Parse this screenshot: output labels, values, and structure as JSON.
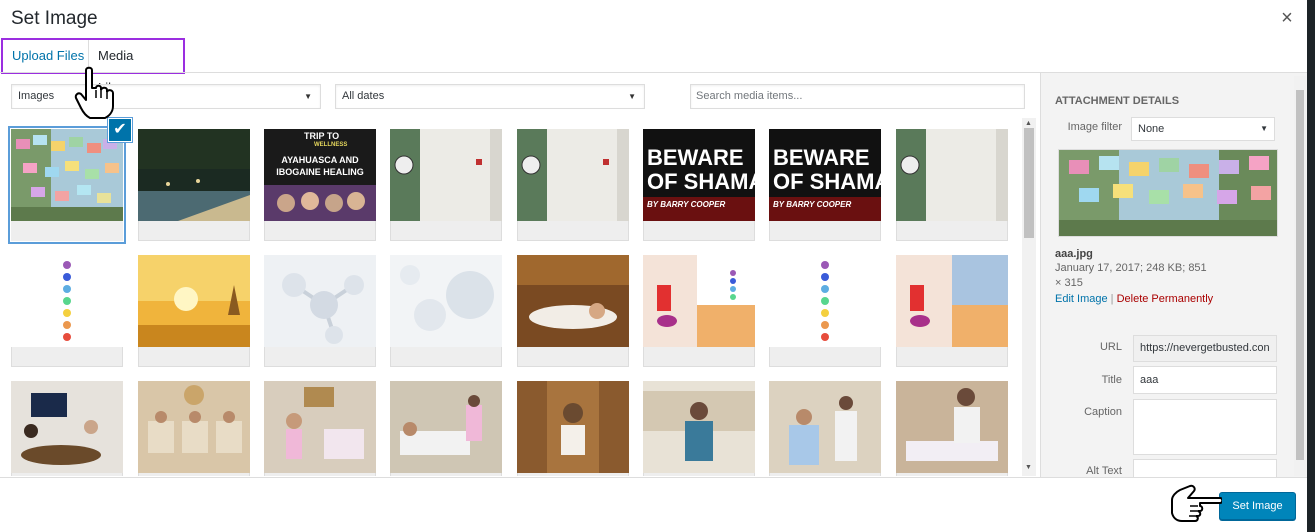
{
  "modal": {
    "title": "Set Image",
    "close_label": "×"
  },
  "tabs": [
    {
      "label": "Upload Files"
    },
    {
      "label": "Media Library"
    }
  ],
  "filters": {
    "type_select": "Images",
    "date_select": "All dates",
    "search_placeholder": "Search media items..."
  },
  "thumbnails": [
    {
      "text": ""
    },
    {
      "text": ""
    },
    {
      "text": "TRIP TO WELLNESS AYAHUASCA AND IBOGAINE HEALING"
    },
    {
      "text": ""
    },
    {
      "text": ""
    },
    {
      "text": "BEWARE OF SHAMA BY BARRY COOPER"
    },
    {
      "text": "BEWARE OF SHAMA BY BARRY COOPER"
    },
    {
      "text": ""
    }
  ],
  "thumb_texts": {
    "t3a": "TRIP TO",
    "t3b": "WELLNESS",
    "t3c": "AYAHUASCA AND",
    "t3d": "IBOGAINE HEALING",
    "bw1": "BEWARE",
    "bw2": "OF SHAMA",
    "bw3": "BY BARRY COOPER"
  },
  "sidebar": {
    "heading": "ATTACHMENT DETAILS",
    "image_filter_label": "Image filter",
    "image_filter_value": "None",
    "filename": "aaa.jpg",
    "date_size": "January 17, 2017; 248 KB; 851",
    "dims_rest": "× 315",
    "edit_link": "Edit Image",
    "sep": "|",
    "delete_link": "Delete Permanently",
    "url_label": "URL",
    "url_value": "https://nevergetbusted.con",
    "title_label": "Title",
    "title_value": "aaa",
    "caption_label": "Caption",
    "alt_label": "Alt Text"
  },
  "footer": {
    "set_button": "Set Image"
  },
  "colors": {
    "accent": "#0085ba",
    "link": "#0073aa",
    "delete": "#aa0000",
    "tab_highlight": "#9b2ee0"
  }
}
